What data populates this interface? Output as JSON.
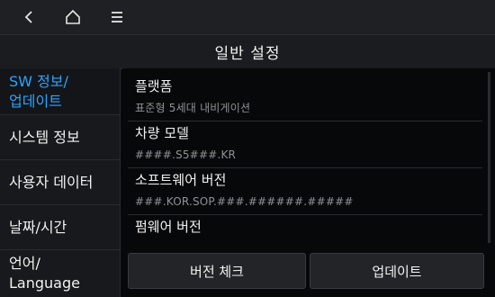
{
  "nav": {
    "back_icon": "back-chevron-icon",
    "home_icon": "home-icon",
    "menu_icon": "menu-icon"
  },
  "header": {
    "title": "일반 설정"
  },
  "sidebar": {
    "items": [
      {
        "line1": "SW 정보/",
        "line2": "업데이트"
      },
      {
        "line1": "시스템 정보",
        "line2": ""
      },
      {
        "line1": "사용자 데이터",
        "line2": ""
      },
      {
        "line1": "날짜/시간",
        "line2": ""
      },
      {
        "line1": "언어/",
        "line2": "Language"
      }
    ],
    "active_index": 0
  },
  "main": {
    "rows": [
      {
        "title": "플랫폼",
        "value": "표준형 5세대 내비게이션"
      },
      {
        "title": "차량 모델",
        "value": "####.S5###.KR"
      },
      {
        "title": "소프트웨어 버전",
        "value": "###.KOR.SOP.###.######.#####"
      },
      {
        "title": "펌웨어 버전",
        "value": ""
      }
    ],
    "buttons": {
      "version_check": "버전 체크",
      "update": "업데이트"
    }
  },
  "colors": {
    "accent": "#2fa3ff",
    "background": "#07080a",
    "bar": "#1f2023",
    "text": "#f2f2f2",
    "muted": "#8f9196"
  }
}
